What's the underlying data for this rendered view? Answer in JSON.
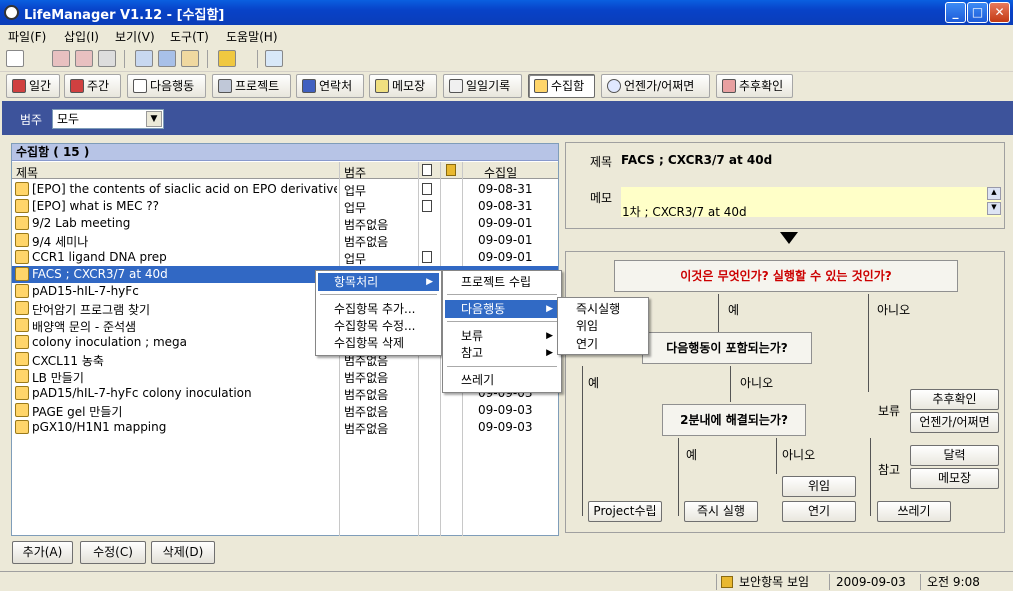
{
  "window": {
    "title": "LifeManager V1.12 - [수집함]"
  },
  "menubar": [
    "파일(F)",
    "삽입(I)",
    "보기(V)",
    "도구(T)",
    "도움말(H)"
  ],
  "nav": [
    "일간",
    "주간",
    "다음행동",
    "프로젝트",
    "연락처",
    "메모장",
    "일일기록",
    "수집함",
    "언젠가/어쩌면",
    "추후확인"
  ],
  "filter": {
    "label": "범주",
    "value": "모두"
  },
  "list": {
    "header": "수집함 ( 15 )",
    "columns": {
      "title": "제목",
      "category": "범주",
      "date": "수집일"
    },
    "rows": [
      {
        "title": "[EPO] the contents of siaclic acid on EPO derivatives ...",
        "category": "업무",
        "memo": true,
        "date": "09-08-31"
      },
      {
        "title": "[EPO] what is MEC ??",
        "category": "업무",
        "memo": true,
        "date": "09-08-31"
      },
      {
        "title": "9/2 Lab meeting",
        "category": "범주없음",
        "memo": false,
        "date": "09-09-01"
      },
      {
        "title": "9/4 세미나",
        "category": "범주없음",
        "memo": false,
        "date": "09-09-01"
      },
      {
        "title": "CCR1 ligand DNA prep",
        "category": "업무",
        "memo": true,
        "date": "09-09-01"
      },
      {
        "title": "FACS ; CXCR3/7 at 40d",
        "category": "",
        "memo": false,
        "date": "",
        "selected": true
      },
      {
        "title": "pAD15-hIL-7-hyFc",
        "category": "",
        "memo": false,
        "date": ""
      },
      {
        "title": "단어암기 프로그램 찾기",
        "category": "",
        "memo": false,
        "date": ""
      },
      {
        "title": "배양액 문의 - 준석샘",
        "category": "",
        "memo": false,
        "date": ""
      },
      {
        "title": "colony inoculation ; mega",
        "category": "",
        "memo": false,
        "date": ""
      },
      {
        "title": "CXCL11 농축",
        "category": "범주없음",
        "memo": false,
        "date": ""
      },
      {
        "title": "LB 만들기",
        "category": "범주없음",
        "memo": false,
        "date": ""
      },
      {
        "title": "pAD15/hIL-7-hyFc colony inoculation",
        "category": "범주없음",
        "memo": false,
        "date": "09-09-03"
      },
      {
        "title": "PAGE gel 만들기",
        "category": "범주없음",
        "memo": false,
        "date": "09-09-03"
      },
      {
        "title": "pGX10/H1N1 mapping",
        "category": "범주없음",
        "memo": false,
        "date": "09-09-03"
      }
    ]
  },
  "detail": {
    "title_label": "제목",
    "title_value": "FACS ; CXCR3/7 at 40d",
    "memo_label": "메모",
    "memo_value": "1차 ; CXCR3/7 at 40d"
  },
  "flow": {
    "q1": "이것은 무엇인가? 실행할 수 있는 것인가?",
    "yes": "예",
    "no": "아니오",
    "q2": "다음행동이 포함되는가?",
    "q3": "2분내에 해결되는가?",
    "boryu": "보류",
    "chamgo": "참고",
    "btn_followup": "추후확인",
    "btn_someday": "언젠가/어쩌면",
    "btn_calendar": "달력",
    "btn_memo": "메모장",
    "btn_project": "Project수립",
    "btn_do_now": "즉시 실행",
    "btn_delegate": "위임",
    "btn_defer": "연기",
    "btn_trash": "쓰레기"
  },
  "buttons": {
    "add": "추가(A)",
    "edit": "수정(C)",
    "delete": "삭제(D)"
  },
  "status": {
    "secure": "보안항목 보임",
    "date": "2009-09-03",
    "time": "오전 9:08"
  },
  "context_menu": {
    "level1": [
      "항목처리",
      "수집항목 추가...",
      "수집항목 수정...",
      "수집항목 삭제"
    ],
    "level2": [
      "프로젝트 수립",
      "다음행동",
      "보류",
      "참고",
      "쓰레기"
    ],
    "level3": [
      "즉시실행",
      "위임",
      "연기"
    ]
  },
  "colors": {
    "filter_bar": "#3d539b",
    "selection": "#3168c4",
    "question_text": "#cc0000",
    "memo_bg": "#ffffc8"
  }
}
